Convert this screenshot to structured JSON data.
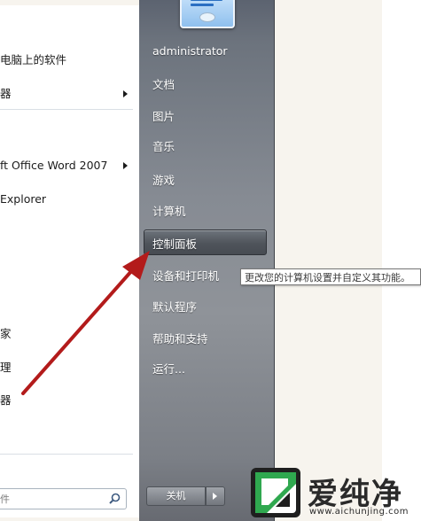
{
  "left_pane": {
    "items": [
      {
        "label": "电脑上的软件",
        "has_submenu": false
      },
      {
        "label": "器",
        "has_submenu": true
      },
      {
        "label": "ft Office Word 2007",
        "has_submenu": true
      },
      {
        "label": "Explorer",
        "has_submenu": false
      },
      {
        "label": "家",
        "has_submenu": false
      },
      {
        "label": "理",
        "has_submenu": false
      },
      {
        "label": "器",
        "has_submenu": false
      }
    ],
    "search_placeholder": "件"
  },
  "right_pane": {
    "user": "administrator",
    "items": [
      "文档",
      "图片",
      "音乐",
      "游戏",
      "计算机",
      "控制面板",
      "设备和打印机",
      "默认程序",
      "帮助和支持",
      "运行..."
    ],
    "highlighted": "控制面板",
    "shutdown_label": "关机"
  },
  "tooltip": "更改您的计算机设置并自定义其功能。",
  "watermark": {
    "text": "爱纯净",
    "url": "www.aichunjing.com"
  },
  "colors": {
    "annotation_arrow": "#b31b1b",
    "right_pane": "#868b93",
    "highlight": "#4f545b"
  }
}
